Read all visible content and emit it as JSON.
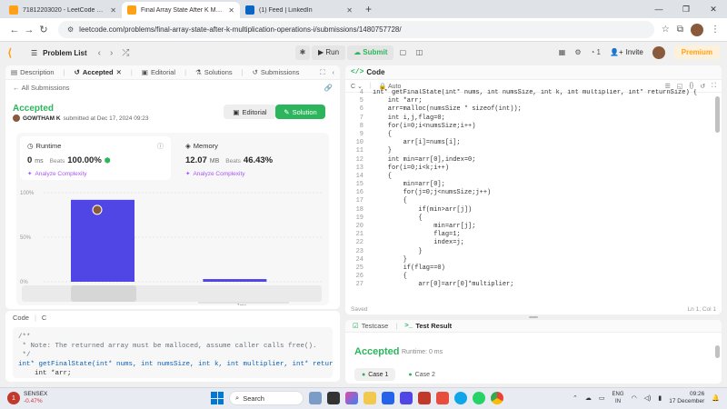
{
  "browser": {
    "tabs": [
      {
        "label": "71812203020 - LeetCode Profil",
        "color": "#ffa116"
      },
      {
        "label": "Final Array State After K Multip",
        "color": "#ffa116",
        "active": true
      },
      {
        "label": "(1) Feed | LinkedIn",
        "color": "#0a66c2"
      }
    ],
    "url": "leetcode.com/problems/final-array-state-after-k-multiplication-operations-i/submissions/1480757728/"
  },
  "nav": {
    "problem_list": "Problem List",
    "run": "Run",
    "submit": "Submit",
    "fire_count": "1",
    "invite": "Invite",
    "premium": "Premium"
  },
  "left_tabs": [
    "Description",
    "Accepted",
    "Editorial",
    "Solutions",
    "Submissions"
  ],
  "submission": {
    "all_submissions": "All Submissions",
    "status": "Accepted",
    "user": "GOWTHAM K",
    "submitted_text": "submitted at Dec 17, 2024 09:23",
    "editorial_btn": "Editorial",
    "solution_btn": "Solution"
  },
  "runtime": {
    "title": "Runtime",
    "value": "0",
    "unit": "ms",
    "beats_label": "Beats",
    "beats": "100.00%",
    "analyze": "Analyze Complexity"
  },
  "memory": {
    "title": "Memory",
    "value": "12.07",
    "unit": "MB",
    "beats_label": "Beats",
    "beats": "46.43%",
    "analyze": "Analyze Complexity"
  },
  "chart_data": {
    "type": "bar",
    "categories": [
      "0ms",
      "1ms"
    ],
    "values": [
      92,
      3
    ],
    "y_ticks": [
      "100%",
      "50%",
      "0%"
    ],
    "ylim": [
      0,
      100
    ],
    "bar_color": "#4f46e5",
    "range_label": "1ms"
  },
  "left_code": {
    "title": "Code",
    "lang": "C",
    "lines": [
      "/**",
      " * Note: The returned array must be malloced, assume caller calls free().",
      " */",
      "int* getFinalState(int* nums, int numsSize, int k, int multiplier, int* returnSi",
      "    int *arr;"
    ]
  },
  "editor": {
    "title": "Code",
    "lang": "C",
    "mode": "Auto",
    "saved": "Saved",
    "position": "Ln 1, Col 1",
    "first_line": 4,
    "lines": [
      "int* getFinalState(int* nums, int numsSize, int k, int multiplier, int* returnSize) {",
      "    int *arr;",
      "    arr=malloc(numsSize * sizeof(int));",
      "    int i,j,flag=0;",
      "    for(i=0;i<numsSize;i++)",
      "    {",
      "        arr[i]=nums[i];",
      "    }",
      "    int min=arr[0],index=0;",
      "    for(i=0;i<k;i++)",
      "    {",
      "        min=arr[0];",
      "        for(j=0;j<numsSize;j++)",
      "        {",
      "            if(min>arr[j])",
      "            {",
      "                min=arr[j];",
      "                flag=1;",
      "                index=j;",
      "            }",
      "        }",
      "        if(flag==0)",
      "        {",
      "            arr[0]=arr[0]*multiplier;"
    ]
  },
  "test": {
    "testcase_tab": "Testcase",
    "result_tab": "Test Result",
    "status": "Accepted",
    "runtime": "Runtime: 0 ms",
    "cases": [
      "Case 1",
      "Case 2"
    ]
  },
  "taskbar": {
    "ticker": "SENSEX",
    "change": "-0.47%",
    "badge": "1",
    "search": "Search",
    "lang1": "ENG",
    "lang2": "IN",
    "time": "09:26",
    "date": "17 December"
  }
}
